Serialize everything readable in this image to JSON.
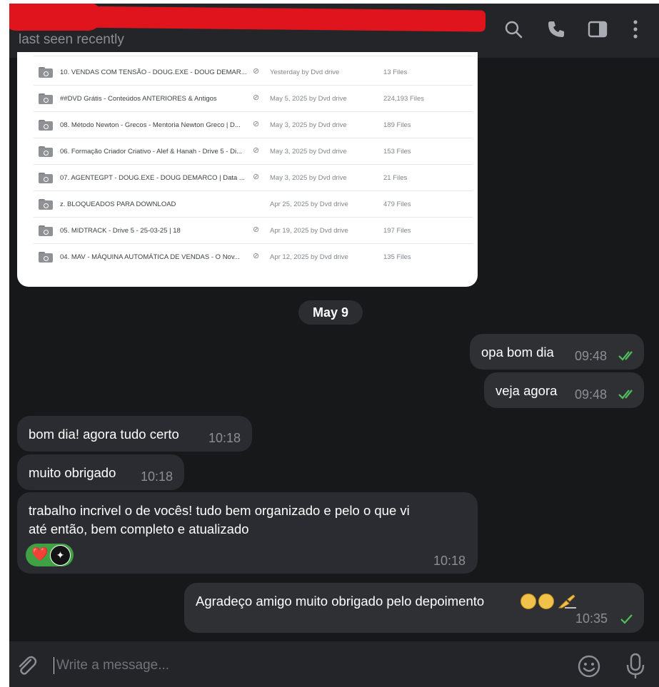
{
  "header": {
    "status": "last seen recently",
    "icons": [
      "search-icon",
      "phone-icon",
      "sidebar-toggle-icon",
      "more-vertical-icon"
    ]
  },
  "file_list": [
    {
      "name": "10. VENDAS COM TENSÃO - DOUG.EXE - DOUG DEMAR...",
      "shared": true,
      "date": "Yesterday by Dvd drive",
      "count": "13 Files"
    },
    {
      "name": "##DVD Grátis - Conteúdos ANTERIORES & Antigos",
      "shared": true,
      "date": "May 5, 2025 by Dvd drive",
      "count": "224,193 Files"
    },
    {
      "name": "08. Método Newton - Grecos - Mentoria Newton Greco | D...",
      "shared": true,
      "date": "May 3, 2025 by Dvd drive",
      "count": "189 Files"
    },
    {
      "name": "06. Formação Criador Criativo - Alef & Hanah - Drive 5 - Di...",
      "shared": true,
      "date": "May 3, 2025 by Dvd drive",
      "count": "153 Files"
    },
    {
      "name": "07. AGENTEGPT - DOUG.EXE - DOUG DEMARCO | Data ...",
      "shared": true,
      "date": "May 3, 2025 by Dvd drive",
      "count": "21 Files"
    },
    {
      "name": "z. BLOQUEADOS PARA DOWNLOAD",
      "shared": false,
      "date": "Apr 25, 2025 by Dvd drive",
      "count": "479 Files"
    },
    {
      "name": "05. MIDTRACK - Drive 5 - 25-03-25 | 18",
      "shared": true,
      "date": "Apr 19, 2025 by Dvd drive",
      "count": "197 Files"
    },
    {
      "name": "04. MAV - MÁQUINA AUTOMÁTICA DE VENDAS - O Nov...",
      "shared": true,
      "date": "Apr 12, 2025 by Dvd drive",
      "count": "135 Files"
    }
  ],
  "date_separator": "May 9",
  "messages": [
    {
      "direction": "out",
      "text": "opa bom dia",
      "time": "09:48",
      "status": "read"
    },
    {
      "direction": "out",
      "text": "veja agora",
      "time": "09:48",
      "status": "read"
    },
    {
      "direction": "in",
      "text": "bom dia! agora tudo certo",
      "time": "10:18"
    },
    {
      "direction": "in",
      "text": "muito obrigado",
      "time": "10:18"
    },
    {
      "direction": "in",
      "lines": [
        "trabalho incrivel o de vocês! tudo bem organizado e pelo o que vi",
        "até então, bem completo e atualizado"
      ],
      "time": "10:18",
      "reactions": [
        "❤️"
      ]
    },
    {
      "direction": "out",
      "text": "Agradeço amigo muito obrigado pelo depoimento",
      "time": "10:35",
      "status": "sent",
      "emojis": [
        "praying-hands",
        "praying-hands",
        "writing-hand"
      ]
    }
  ],
  "composer": {
    "placeholder": "Write a message...",
    "icons": [
      "attach-icon",
      "emoji-icon",
      "microphone-icon"
    ]
  },
  "colors": {
    "background": "#17181a",
    "bubble": "#2a2c31",
    "check": "#4fbf5a",
    "reaction": "#3fa144",
    "redaction": "#e0141d"
  }
}
